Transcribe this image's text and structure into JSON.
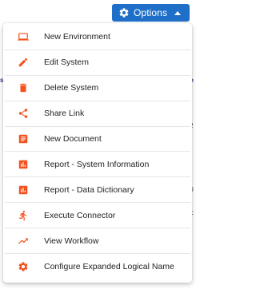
{
  "toolbar": {
    "options_label": "Options",
    "button_color": "#1f6fc9"
  },
  "menu": {
    "icon_color": "#f4511e",
    "items": [
      {
        "label": "New Environment",
        "icon": "laptop-icon"
      },
      {
        "label": "Edit System",
        "icon": "pencil-icon"
      },
      {
        "label": "Delete System",
        "icon": "trash-icon"
      },
      {
        "label": "Share Link",
        "icon": "share-icon"
      },
      {
        "label": "New Document",
        "icon": "document-icon"
      },
      {
        "label": "Report - System Information",
        "icon": "bar-chart-icon"
      },
      {
        "label": "Report - Data Dictionary",
        "icon": "bar-chart-icon"
      },
      {
        "label": "Execute Connector",
        "icon": "running-person-icon"
      },
      {
        "label": "View Workflow",
        "icon": "trending-up-icon"
      },
      {
        "label": "Configure Expanded Logical Name",
        "icon": "gear-icon"
      }
    ]
  }
}
